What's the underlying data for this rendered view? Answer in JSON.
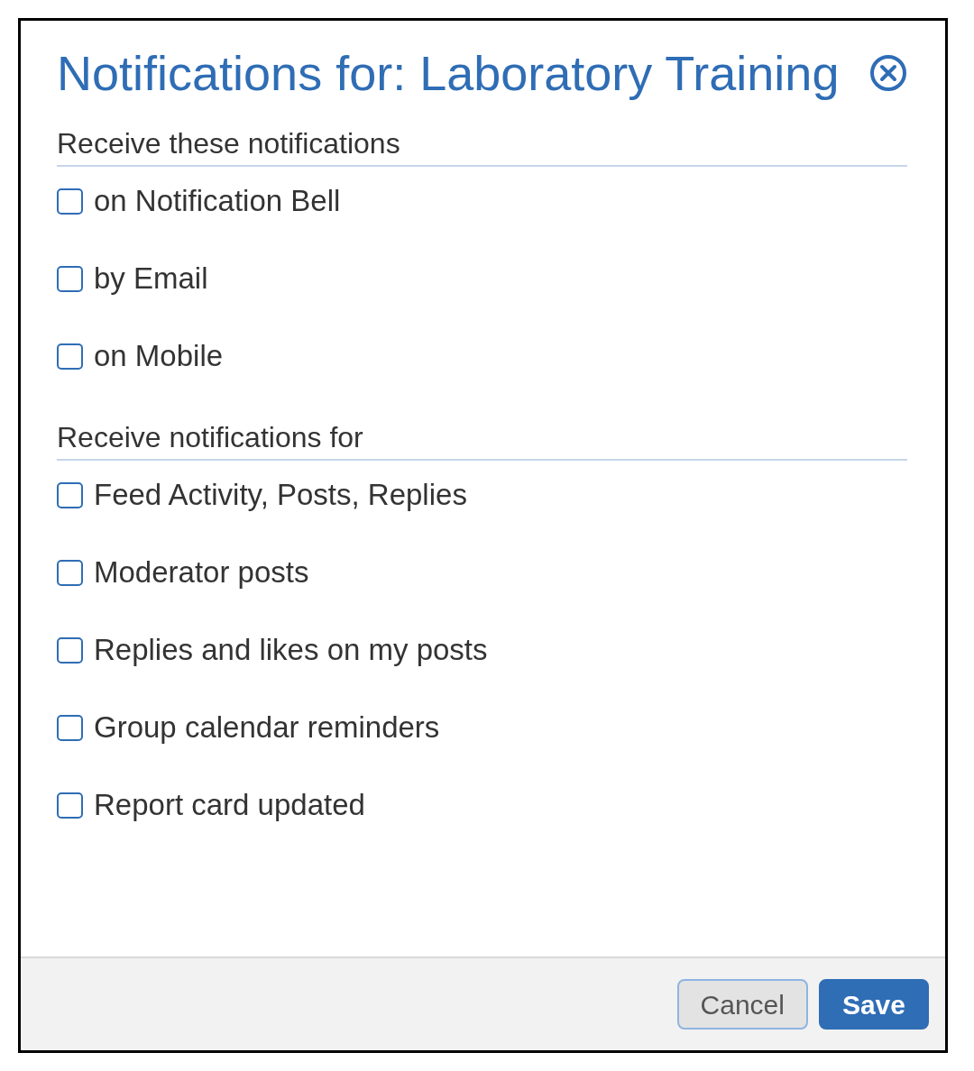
{
  "dialog": {
    "title": "Notifications for: Laboratory Training"
  },
  "sections": [
    {
      "heading": "Receive these notifications",
      "options": [
        {
          "label": "on Notification Bell",
          "checked": false
        },
        {
          "label": "by Email",
          "checked": false
        },
        {
          "label": "on Mobile",
          "checked": false
        }
      ]
    },
    {
      "heading": "Receive notifications for",
      "options": [
        {
          "label": "Feed Activity, Posts, Replies",
          "checked": false
        },
        {
          "label": "Moderator posts",
          "checked": false
        },
        {
          "label": "Replies and likes on my posts",
          "checked": false
        },
        {
          "label": "Group calendar reminders",
          "checked": false
        },
        {
          "label": "Report card updated",
          "checked": false
        }
      ]
    }
  ],
  "buttons": [
    {
      "label": "Cancel",
      "kind": "secondary"
    },
    {
      "label": "Save",
      "kind": "primary"
    }
  ]
}
